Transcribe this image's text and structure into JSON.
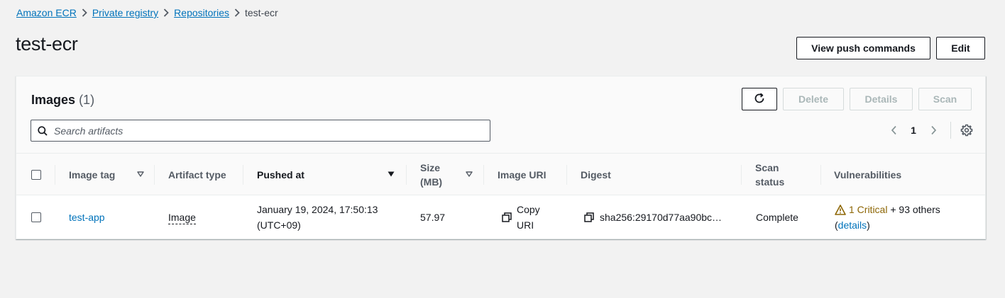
{
  "breadcrumb": {
    "items": [
      "Amazon ECR",
      "Private registry",
      "Repositories"
    ],
    "current": "test-ecr"
  },
  "page": {
    "title": "test-ecr",
    "view_push_label": "View push commands",
    "edit_label": "Edit"
  },
  "images": {
    "title": "Images",
    "count": "(1)",
    "refresh_icon": "refresh-icon",
    "delete_label": "Delete",
    "details_label": "Details",
    "scan_label": "Scan",
    "search_placeholder": "Search artifacts",
    "current_page": "1"
  },
  "table": {
    "columns": {
      "image_tag": "Image tag",
      "artifact_type": "Artifact type",
      "pushed_at": "Pushed at",
      "size_line1": "Size",
      "size_line2": "(MB)",
      "image_uri": "Image URI",
      "digest": "Digest",
      "scan_line1": "Scan",
      "scan_line2": "status",
      "vulnerabilities": "Vulnerabilities"
    },
    "rows": [
      {
        "image_tag": "test-app",
        "artifact_type": "Image",
        "pushed_line1": "January 19, 2024, 17:50:13",
        "pushed_line2": "(UTC+09)",
        "size": "57.97",
        "uri_line1": "Copy",
        "uri_line2": "URI",
        "digest": "sha256:29170d77aa90bc…",
        "scan_status": "Complete",
        "vuln_critical": "1 Critical",
        "vuln_others": " + 93 others",
        "vuln_open": "(",
        "vuln_details": "details",
        "vuln_close": ")"
      }
    ]
  },
  "colors": {
    "link": "#0073bb",
    "critical": "#8d6605",
    "text": "#16191f"
  }
}
